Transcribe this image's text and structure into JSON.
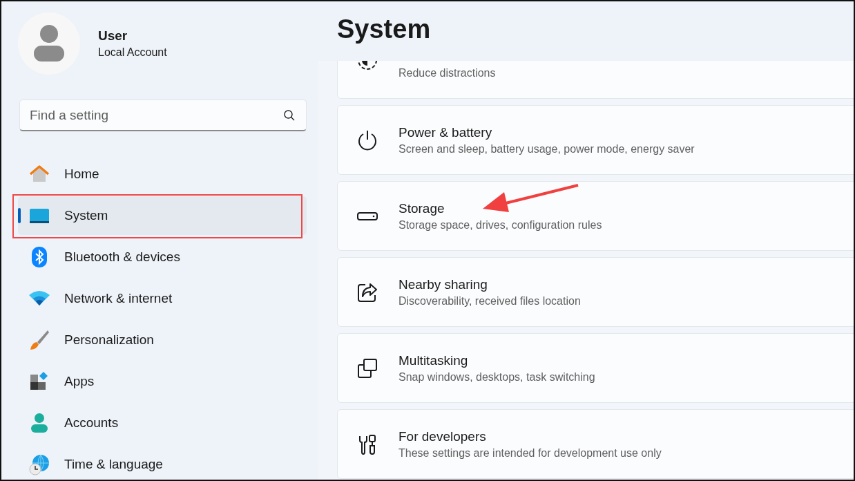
{
  "account": {
    "name": "User",
    "type": "Local Account"
  },
  "search": {
    "placeholder": "Find a setting"
  },
  "sidebar": {
    "items": [
      {
        "label": "Home",
        "kind": "home",
        "selected": false,
        "highlighted": false
      },
      {
        "label": "System",
        "kind": "system",
        "selected": true,
        "highlighted": true
      },
      {
        "label": "Bluetooth & devices",
        "kind": "bluetooth",
        "selected": false,
        "highlighted": false
      },
      {
        "label": "Network & internet",
        "kind": "wifi",
        "selected": false,
        "highlighted": false
      },
      {
        "label": "Personalization",
        "kind": "brush",
        "selected": false,
        "highlighted": false
      },
      {
        "label": "Apps",
        "kind": "apps",
        "selected": false,
        "highlighted": false
      },
      {
        "label": "Accounts",
        "kind": "person",
        "selected": false,
        "highlighted": false
      },
      {
        "label": "Time & language",
        "kind": "globe",
        "selected": false,
        "highlighted": false
      }
    ]
  },
  "page": {
    "title": "System"
  },
  "cards": [
    {
      "kind": "focus",
      "description": "Reduce distractions",
      "pointed": false
    },
    {
      "kind": "power",
      "title": "Power & battery",
      "description": "Screen and sleep, battery usage, power mode, energy saver",
      "pointed": false
    },
    {
      "kind": "storage",
      "title": "Storage",
      "description": "Storage space, drives, configuration rules",
      "pointed": true
    },
    {
      "kind": "share",
      "title": "Nearby sharing",
      "description": "Discoverability, received files location",
      "pointed": false
    },
    {
      "kind": "multitask",
      "title": "Multitasking",
      "description": "Snap windows, desktops, task switching",
      "pointed": false
    },
    {
      "kind": "dev",
      "title": "For developers",
      "description": "These settings are intended for development use only",
      "pointed": false
    }
  ]
}
